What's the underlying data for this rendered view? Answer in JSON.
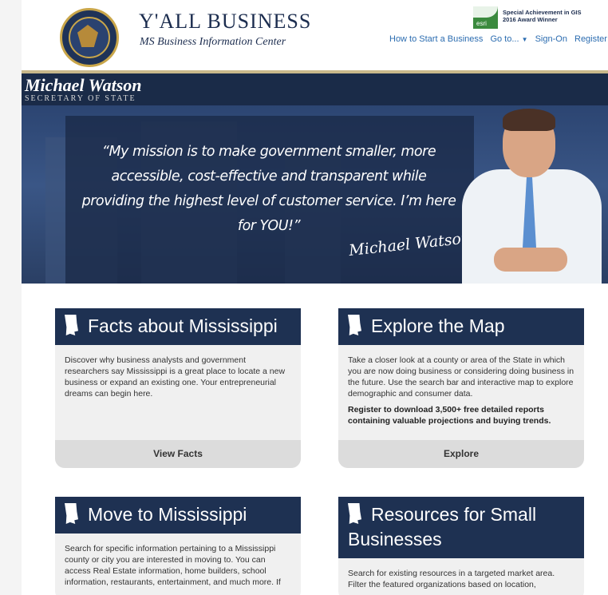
{
  "header": {
    "title": "Y'ALL BUSINESS",
    "subtitle": "MS Business Information Center",
    "seal_name": "seal-of-mississippi-secretary-of-state",
    "award": {
      "logo_text": "esri",
      "line1": "Special Achievement in GIS",
      "line2": "2016 Award Winner"
    },
    "nav": {
      "start_business": "How to Start a Business",
      "goto": "Go to...",
      "sign_on": "Sign-On",
      "register": "Register"
    }
  },
  "banner": {
    "name": "Michael Watson",
    "title": "SECRETARY OF STATE",
    "quote": "“My mission is to make government smaller, more accessible, cost-effective and transparent while providing the highest level of customer service. I’m here for YOU!”",
    "signature": "Michael Watson"
  },
  "cards": [
    {
      "title": "Facts about Mississippi",
      "body": "Discover why business analysts and government researchers say Mississippi is a great place to locate a new business or expand an existing one. Your entrepreneurial dreams can begin here.",
      "action": "View Facts"
    },
    {
      "title": "Explore the Map",
      "body": "Take a closer look at a county or area of the State in which you are now doing business or considering doing business in the future. Use the search bar and interactive map to explore demographic and consumer data.",
      "body_bold": "Register to download 3,500+ free detailed reports containing valuable projections and buying trends.",
      "action": "Explore"
    },
    {
      "title": "Move to Mississippi",
      "body": "Search for specific information pertaining to a Mississippi county or city you are interested in moving to. You can access Real Estate information, home builders, school information, restaurants, entertainment, and much more. If"
    },
    {
      "title": "Resources for Small Businesses",
      "body": "Search for existing resources in a targeted market area. Filter the featured organizations based on location,"
    }
  ],
  "colors": {
    "navy": "#1e3152",
    "link": "#2b6cb0",
    "card_bg": "#f0f0f0",
    "card_footer": "#dcdcdc"
  }
}
